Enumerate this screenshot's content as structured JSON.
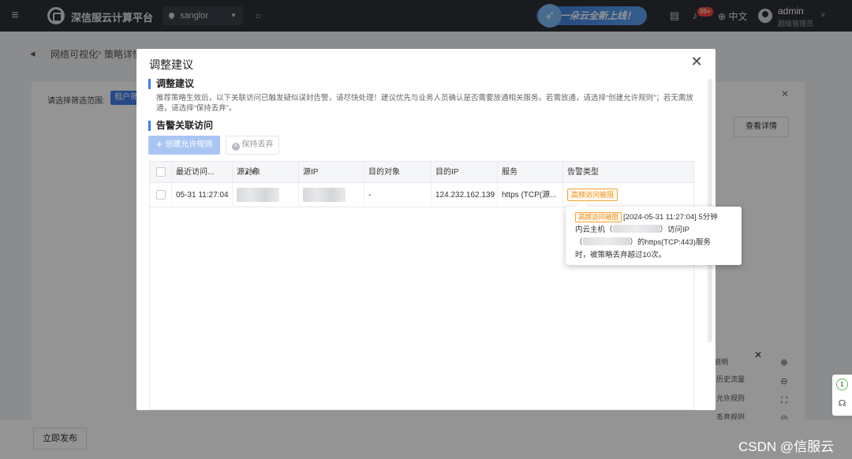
{
  "topbar": {
    "brand": "深信服云计算平台",
    "region": "sanglor",
    "promo": "一朵云全新上线！",
    "notification_count": "99+",
    "language": "中文",
    "user_name": "admin",
    "user_role": "超级管理员"
  },
  "background": {
    "breadcrumb_1": "网络可视化",
    "breadcrumb_sep": ">",
    "breadcrumb_2": "策略详情",
    "filter_label": "请选择筛选范围:",
    "filter_tag": "租户筛",
    "view_detail": "查看详情",
    "legend_title": "说明",
    "legend_items": [
      "历史流量",
      "允许规则",
      "丢弃规则"
    ],
    "publish_button": "立即发布"
  },
  "modal": {
    "title": "调整建议",
    "section_advice": "调整建议",
    "advice_text": "推荐策略生效后，以下关联访问已触发疑似误封告警，请尽快处理！建议优先与业务人员确认是否需要放通相关服务。若需放通，请选择“创建允许规则”；若无需放通，请选择“保持丢弃”。",
    "section_related": "告警关联访问",
    "btn_create": "创建允许规则",
    "btn_keep": "保持丢弃",
    "table": {
      "headers": [
        "最近访问...",
        "源对象",
        "源IP",
        "目的对象",
        "目的IP",
        "服务",
        "告警类型"
      ],
      "row": {
        "time": "05-31 11:27:04",
        "dest_object": "-",
        "dest_ip": "124.232.162.139",
        "service": "https (TCP(源...",
        "alert_type": "高频访问被阻"
      }
    },
    "tooltip": {
      "tag": "高频访问被阻",
      "line1": "[2024-05-31 11:27:04] 5分钟",
      "line2a": "内云主机（",
      "line2b": "）访问IP",
      "line3a": "（",
      "line3b": "）的https(TCP:443)服务",
      "line4": "时，被策略丢弃超过10次。"
    }
  },
  "side_widget": {
    "count": "1"
  },
  "watermark": "CSDN @信服云",
  "colors": {
    "topbar": "#2b2f36",
    "accent": "#3f7ee8",
    "alert": "#f08c14"
  }
}
